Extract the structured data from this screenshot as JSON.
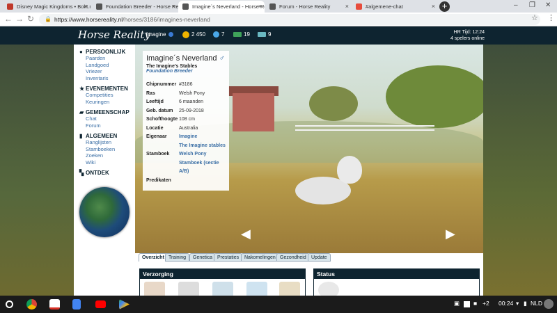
{
  "browser": {
    "tabs": [
      {
        "label": "Disney Magic Kingdoms • Bokt.nl",
        "color": "#c0392b"
      },
      {
        "label": "Foundation Breeder - Horse Reali",
        "color": "#555555"
      },
      {
        "label": "Imagine´s Neverland - Horse Reali",
        "color": "#555555"
      },
      {
        "label": "Forum - Horse Reality",
        "color": "#555555"
      },
      {
        "label": "#algemene-chat",
        "color": "#e74c3c"
      }
    ],
    "url_host": "https://www.horsereality.nl",
    "url_path": "/horses/3186/imagines-neverland",
    "new_tab": "+"
  },
  "site": {
    "logo": "Horse Reality",
    "user": "Imagine",
    "coins": "2 450",
    "gems": "7",
    "cash1": "19",
    "cash2": "9",
    "time": "HR Tijd: 12:24",
    "online": "4 spelers online"
  },
  "sidebar": {
    "sections": [
      {
        "title": "PERSOONLIJK",
        "icon": "user-icon",
        "links": [
          "Paarden",
          "Landgoed",
          "Vriezer",
          "Inventaris"
        ]
      },
      {
        "title": "EVENEMENTEN",
        "icon": "star-icon",
        "links": [
          "Competities",
          "Keuringen"
        ]
      },
      {
        "title": "GEMEENSCHAP",
        "icon": "chat-icon",
        "links": [
          "Chat",
          "Forum"
        ]
      },
      {
        "title": "ALGEMEEN",
        "icon": "bookmark-icon",
        "links": [
          "Ranglijsten",
          "Stamboeken",
          "Zoeken",
          "Wiki"
        ]
      },
      {
        "title": "ONTDEK",
        "icon": "map-icon",
        "links": []
      }
    ]
  },
  "horse": {
    "name": "Imagine´s Neverland",
    "sex_symbol": "♂",
    "stable": "The Imagine's Stables",
    "breeder_label": "Foundation Breeder",
    "info": [
      {
        "key": "Chipnummer",
        "value": "#3186"
      },
      {
        "key": "Ras",
        "value": "Welsh Pony"
      },
      {
        "key": "Leeftijd",
        "value": "6 maanden"
      },
      {
        "key": "Geb. datum",
        "value": "25-09-2018"
      },
      {
        "key": "Schofthoogte",
        "value": "108 cm"
      },
      {
        "key": "Locatie",
        "value": "Australia"
      },
      {
        "key": "Eigenaar",
        "value": "Imagine",
        "value2": "The Imagine stables"
      },
      {
        "key": "Stamboek",
        "value": "Welsh Pony",
        "value2": "Stamboek (sectie",
        "value3": "A/B)"
      },
      {
        "key": "Predikaten",
        "value": ""
      }
    ]
  },
  "tabs": [
    "Overzicht",
    "Training",
    "Genetica",
    "Prestaties",
    "Nakomelingen",
    "Gezondheid",
    "Update"
  ],
  "panels": {
    "left_title": "Verzorging",
    "right_title": "Status"
  },
  "taskbar": {
    "count": "+2",
    "time": "00:24",
    "locale": "NLD"
  },
  "colors": {
    "header_bg": "#0e2430",
    "link": "#3a6ea5",
    "accent_coin": "#f0b400"
  }
}
